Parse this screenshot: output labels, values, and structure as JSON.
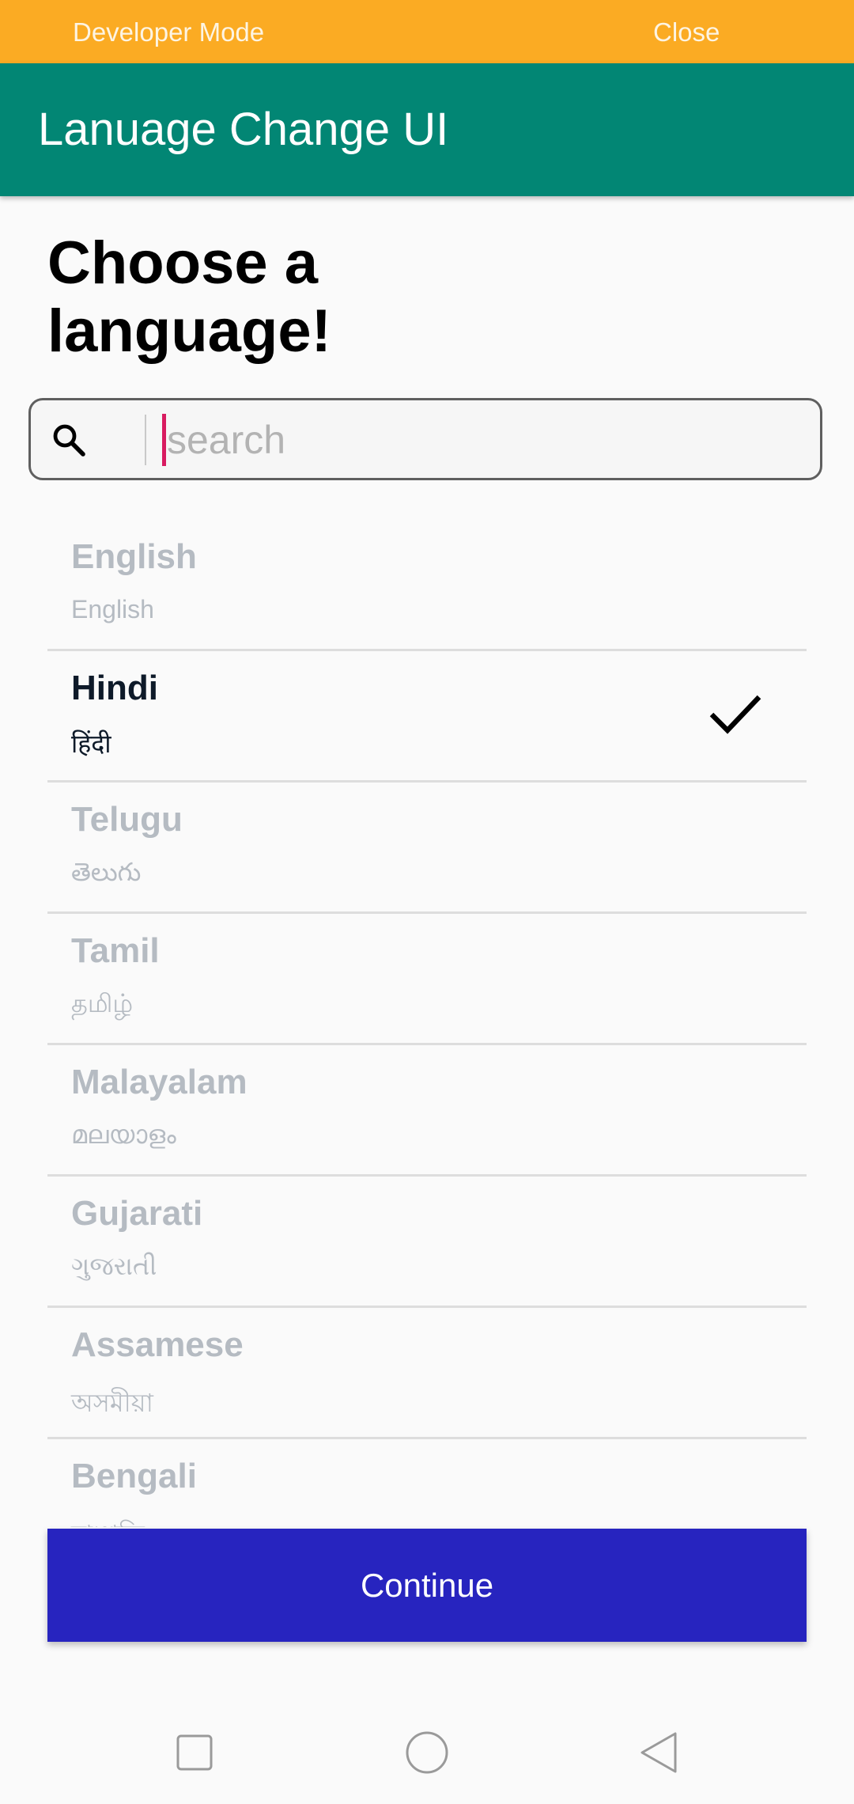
{
  "devbar": {
    "label": "Developer Mode",
    "close": "Close",
    "color": "#fbab23"
  },
  "appbar": {
    "title": "Lanuage Change UI",
    "color": "#028674"
  },
  "heading": "Choose a language!",
  "search": {
    "placeholder": "search",
    "value": "",
    "icon": "search-icon"
  },
  "languages": [
    {
      "name": "English",
      "native": "English",
      "selected": false
    },
    {
      "name": "Hindi",
      "native": "हिंदी",
      "selected": true
    },
    {
      "name": "Telugu",
      "native": "తెలుగు",
      "selected": false
    },
    {
      "name": "Tamil",
      "native": "தமிழ்",
      "selected": false
    },
    {
      "name": "Malayalam",
      "native": "മലയാളം",
      "selected": false
    },
    {
      "name": "Gujarati",
      "native": "ગુજરાતી",
      "selected": false
    },
    {
      "name": "Assamese",
      "native": "অসমীয়া",
      "selected": false
    },
    {
      "name": "Bengali",
      "native": "বাঙালি",
      "selected": false
    }
  ],
  "selected_icon": "check-icon",
  "continue_label": "Continue",
  "continue_color": "#2724bf",
  "navbar": {
    "recents_icon": "square-icon",
    "home_icon": "circle-icon",
    "back_icon": "triangle-back-icon"
  }
}
